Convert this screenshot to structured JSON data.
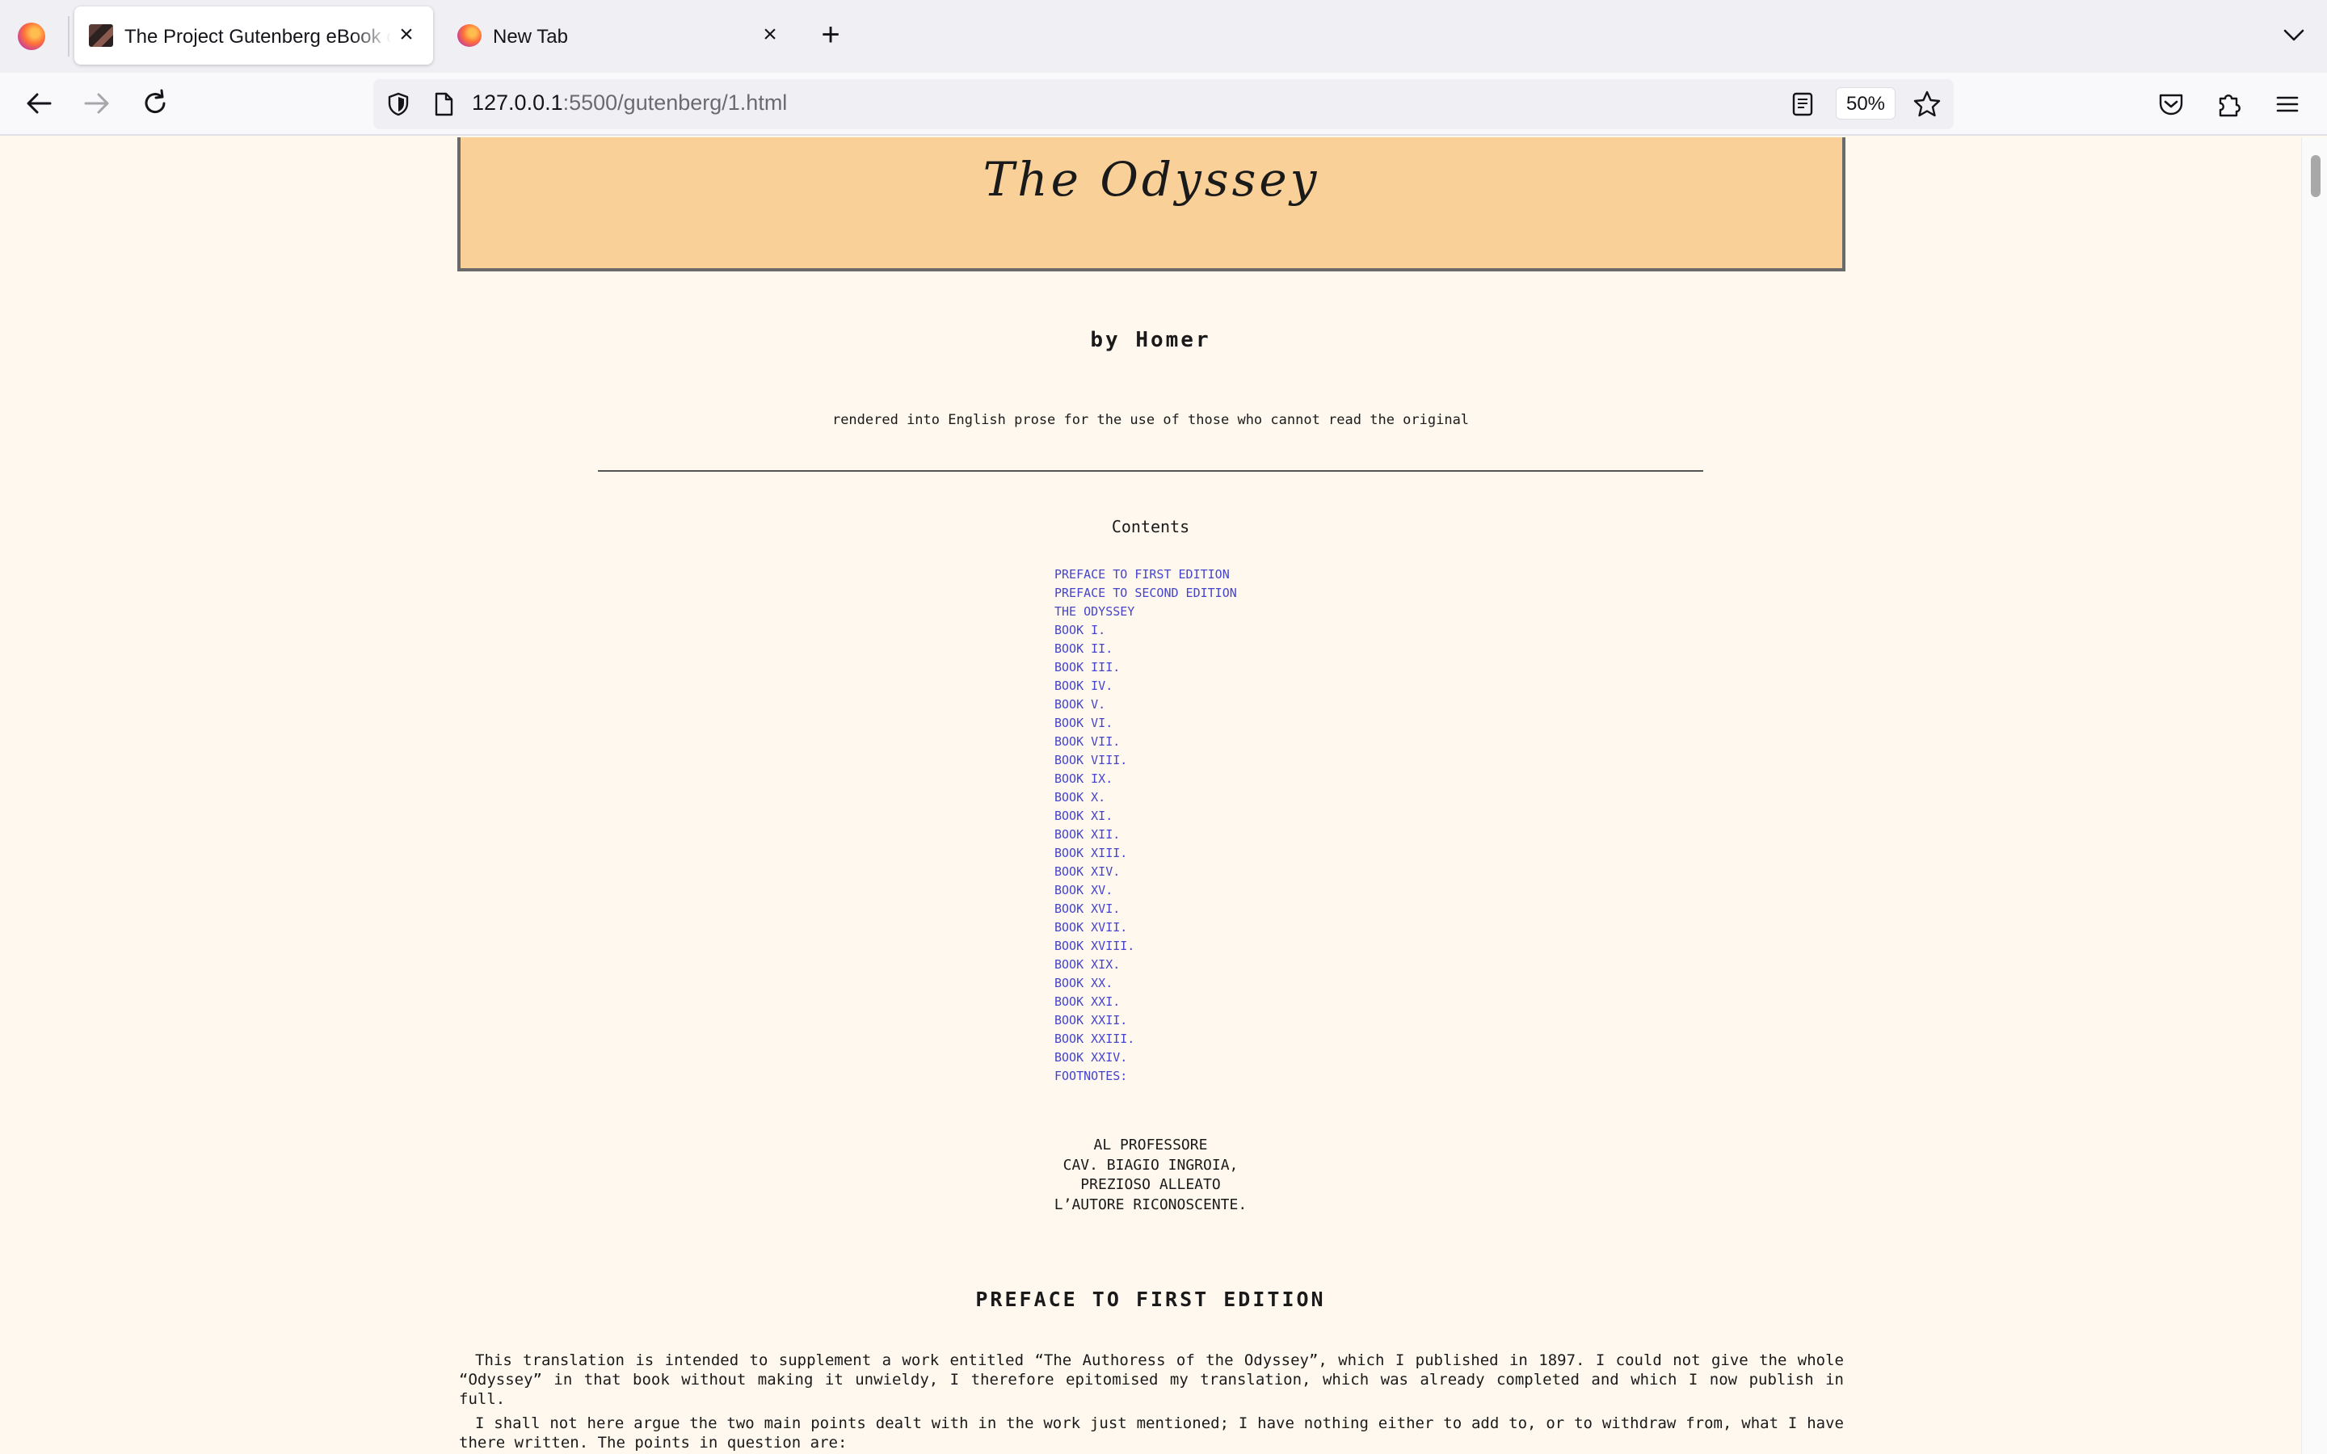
{
  "browser": {
    "tabs": [
      {
        "title": "The Project Gutenberg eBook of The Odyssey, by Homer",
        "active": true
      },
      {
        "title": "New Tab",
        "active": false
      }
    ],
    "url": {
      "host": "127.0.0.1",
      "rest": ":5500/gutenberg/1.html"
    },
    "zoom": "50%"
  },
  "page": {
    "title": "The Odyssey",
    "byline": "by Homer",
    "subtitle": "rendered into English prose for the use of those who cannot read the original",
    "contents_heading": "Contents",
    "toc": [
      "PREFACE TO FIRST EDITION",
      "PREFACE TO SECOND EDITION",
      "THE ODYSSEY",
      "BOOK I.",
      "BOOK II.",
      "BOOK III.",
      "BOOK IV.",
      "BOOK V.",
      "BOOK VI.",
      "BOOK VII.",
      "BOOK VIII.",
      "BOOK IX.",
      "BOOK X.",
      "BOOK XI.",
      "BOOK XII.",
      "BOOK XIII.",
      "BOOK XIV.",
      "BOOK XV.",
      "BOOK XVI.",
      "BOOK XVII.",
      "BOOK XVIII.",
      "BOOK XIX.",
      "BOOK XX.",
      "BOOK XXI.",
      "BOOK XXII.",
      "BOOK XXIII.",
      "BOOK XXIV.",
      "FOOTNOTES:"
    ],
    "dedication": [
      "AL PROFESSORE",
      "CAV. BIAGIO INGROIA,",
      "PREZIOSO ALLEATO",
      "L’AUTORE RICONOSCENTE."
    ],
    "preface_heading": "PREFACE TO FIRST EDITION",
    "preface_paragraphs": [
      "This translation is intended to supplement a work entitled “The Authoress of the Odyssey”, which I published in 1897. I could not give the whole “Odyssey” in that book without making it unwieldy, I therefore epitomised my translation, which was already completed and which I now publish in full.",
      "I shall not here argue the two main points dealt with in the work just mentioned; I have nothing either to add to, or to withdraw from, what I have there written. The points in question are:"
    ]
  },
  "colors": {
    "page_bg": "#fff8ee",
    "title_box_bg": "#f8d098",
    "link": "#4444cc"
  }
}
